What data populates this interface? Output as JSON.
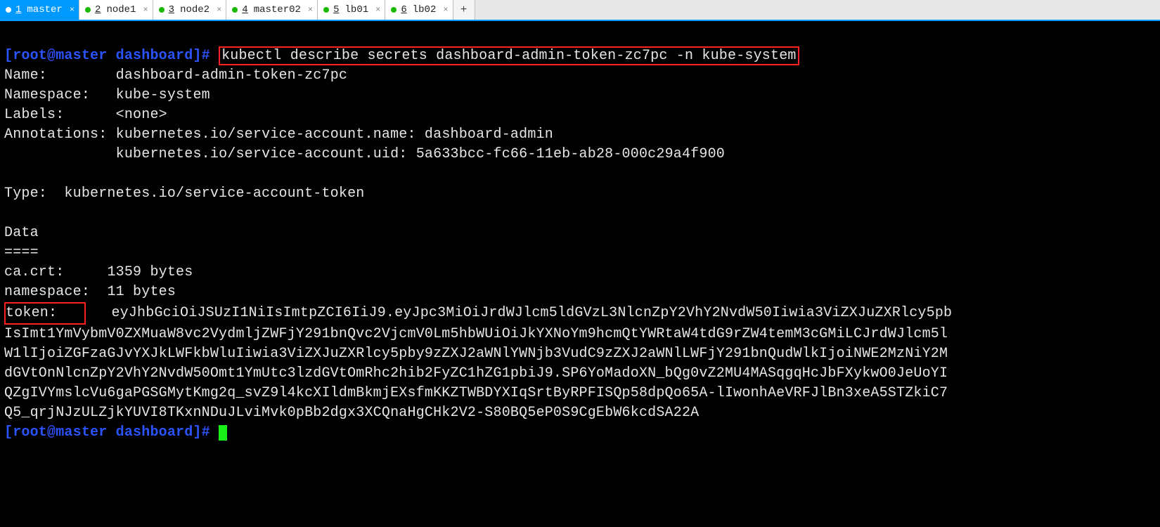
{
  "tabs": [
    {
      "num": "1",
      "label": "master",
      "active": true
    },
    {
      "num": "2",
      "label": "node1",
      "active": false
    },
    {
      "num": "3",
      "label": "node2",
      "active": false
    },
    {
      "num": "4",
      "label": "master02",
      "active": false
    },
    {
      "num": "5",
      "label": "lb01",
      "active": false
    },
    {
      "num": "6",
      "label": "lb02",
      "active": false
    }
  ],
  "add_tab": "+",
  "prompt": {
    "open": "[",
    "user_host": "root@master",
    "space": " ",
    "path": "dashboard",
    "close": "]",
    "hash": "#"
  },
  "command": "kubectl describe secrets dashboard-admin-token-zc7pc -n kube-system",
  "out": {
    "name_label": "Name:        ",
    "name_value": "dashboard-admin-token-zc7pc",
    "ns_label": "Namespace:   ",
    "ns_value": "kube-system",
    "labels_label": "Labels:      ",
    "labels_value": "<none>",
    "anno_label": "Annotations: ",
    "anno_line1": "kubernetes.io/service-account.name: dashboard-admin",
    "anno_pad": "             ",
    "anno_line2": "kubernetes.io/service-account.uid: 5a633bcc-fc66-11eb-ab28-000c29a4f900",
    "type_line": "Type:  kubernetes.io/service-account-token",
    "data_header": "Data",
    "data_bar": "====",
    "cacrt_label": "ca.crt:     ",
    "cacrt_value": "1359 bytes",
    "nsb_label": "namespace:  ",
    "nsb_value": "11 bytes",
    "token_label": "token:   ",
    "token_pad": "   ",
    "token_l1": "eyJhbGciOiJSUzI1NiIsImtpZCI6IiJ9.eyJpc3MiOiJrdWJlcm5ldGVzL3NlcnZpY2VhY2NvdW50Iiwia3ViZXJuZXRlcy5pb",
    "token_l2": "IsImt1YmVybmV0ZXMuaW8vc2VydmljZWFjY291bnQvc2VjcmV0Lm5hbWUiOiJkYXNoYm9hcmQtYWRtaW4tdG9rZW4temM3cGMiLCJrdWJlcm5l",
    "token_l3": "W1lIjoiZGFzaGJvYXJkLWFkbWluIiwia3ViZXJuZXRlcy5pby9zZXJ2aWNlYWNjb3VudC9zZXJ2aWNlLWFjY291bnQudWlkIjoiNWE2MzNiY2M",
    "token_l4": "dGVtOnNlcnZpY2VhY2NvdW50Omt1YmUtc3lzdGVtOmRhc2hib2FyZC1hZG1pbiJ9.SP6YoMadoXN_bQg0vZ2MU4MASqgqHcJbFXykwO0JeUoYI",
    "token_l5": "QZgIVYmslcVu6gaPGSGMytKmg2q_svZ9l4kcXIldmBkmjEXsfmKKZTWBDYXIqSrtByRPFISQp58dpQo65A-lIwonhAeVRFJlBn3xeA5STZkiC7",
    "token_l6": "Q5_qrjNJzULZjkYUVI8TKxnNDuJLviMvk0pBb2dgx3XCQnaHgCHk2V2-S80BQ5eP0S9CgEbW6kcdSA22A"
  }
}
